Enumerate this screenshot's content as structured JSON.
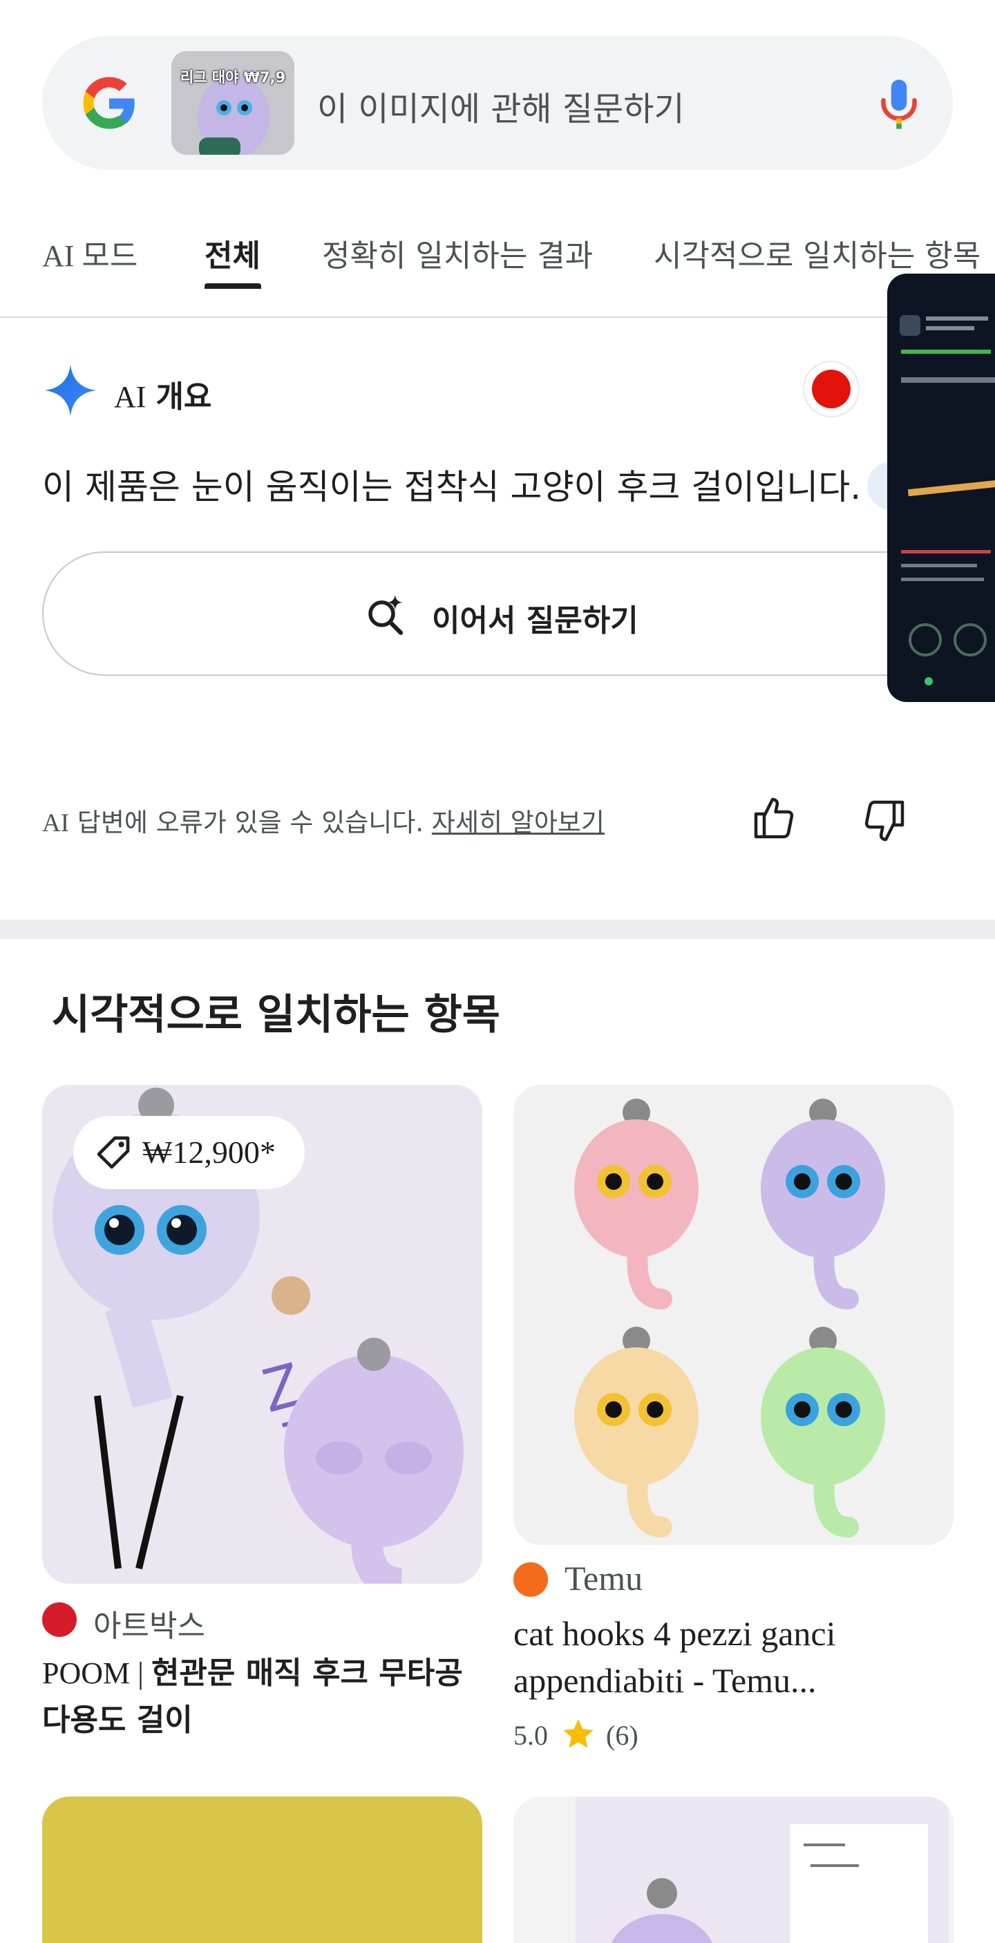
{
  "search": {
    "placeholder": "이 이미지에 관해 질문하기",
    "thumbnail_caption": "리그 대야 ₩7,9"
  },
  "tabs": [
    {
      "label": "AI 모드"
    },
    {
      "label": "전체",
      "active": true
    },
    {
      "label": "정확히 일치하는 결과"
    },
    {
      "label": "시각적으로 일치하는 항목"
    }
  ],
  "ai_overview": {
    "title_ai": "AI",
    "title_rest": "개요",
    "text": "이 제품은 눈이 움직이는 접착식 고양이 후크 걸이입니다.",
    "followup_label": "이어서 질문하기",
    "disclaimer_ai": "AI",
    "disclaimer_text": " 답변에 오류가 있을 수 있습니다. ",
    "disclaimer_link": "자세히 알아보기"
  },
  "visual_matches": {
    "title": "시각적으로 일치하는 항목",
    "cards": [
      {
        "price": "₩12,900*",
        "source": "아트박스",
        "title_prefix": "POOM | ",
        "title_bold": "현관문 매직 후크 무타공 다용도 걸이"
      },
      {
        "source": "Temu",
        "title": "cat hooks 4 pezzi ganci appendiabiti - Temu...",
        "rating": "5.0",
        "rating_count": "(6)"
      }
    ]
  },
  "colors": {
    "accent_blue": "#4285f4",
    "source_poom": "#d61c2a",
    "source_temu": "#f36b1b",
    "star": "#fbbc04"
  },
  "icons": [
    "google-logo-icon",
    "mic-icon",
    "sparkle-icon",
    "search-sparkle-icon",
    "thumbs-up-icon",
    "thumbs-down-icon",
    "tag-icon",
    "star-icon"
  ]
}
